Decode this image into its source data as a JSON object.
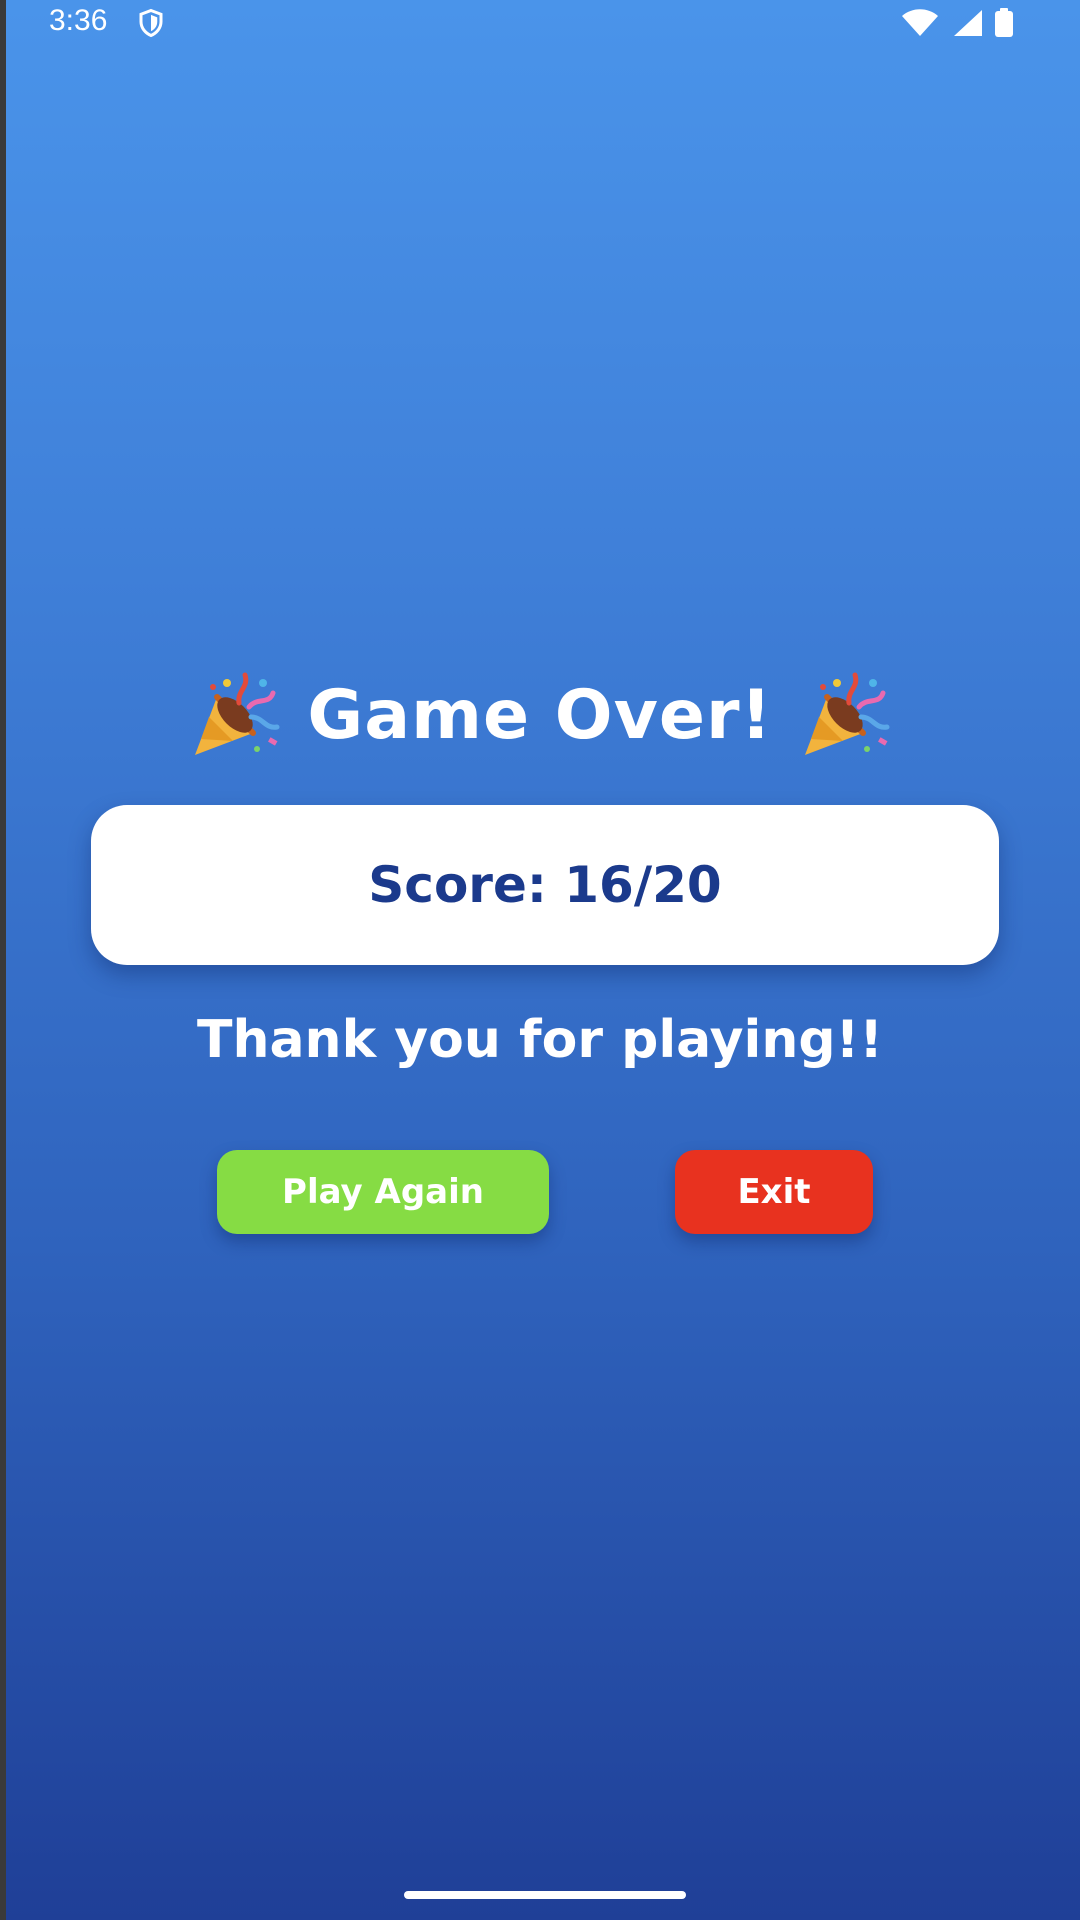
{
  "status_bar": {
    "time": "3:36",
    "left_icon": "shield-icon",
    "right_icons": [
      "wifi-icon",
      "signal-icon",
      "battery-icon"
    ]
  },
  "game_over": {
    "title": "Game Over!",
    "decoration_icon": "party-popper-icon",
    "score_label": "Score: 16/20",
    "message": "Thank you for playing!!"
  },
  "actions": {
    "play_again_label": "Play Again",
    "exit_label": "Exit"
  },
  "colors": {
    "background_top": "#4a94ea",
    "background_bottom": "#1f3f97",
    "score_text": "#1b3a8c",
    "play_again": "#86dc44",
    "exit": "#e8321f"
  }
}
